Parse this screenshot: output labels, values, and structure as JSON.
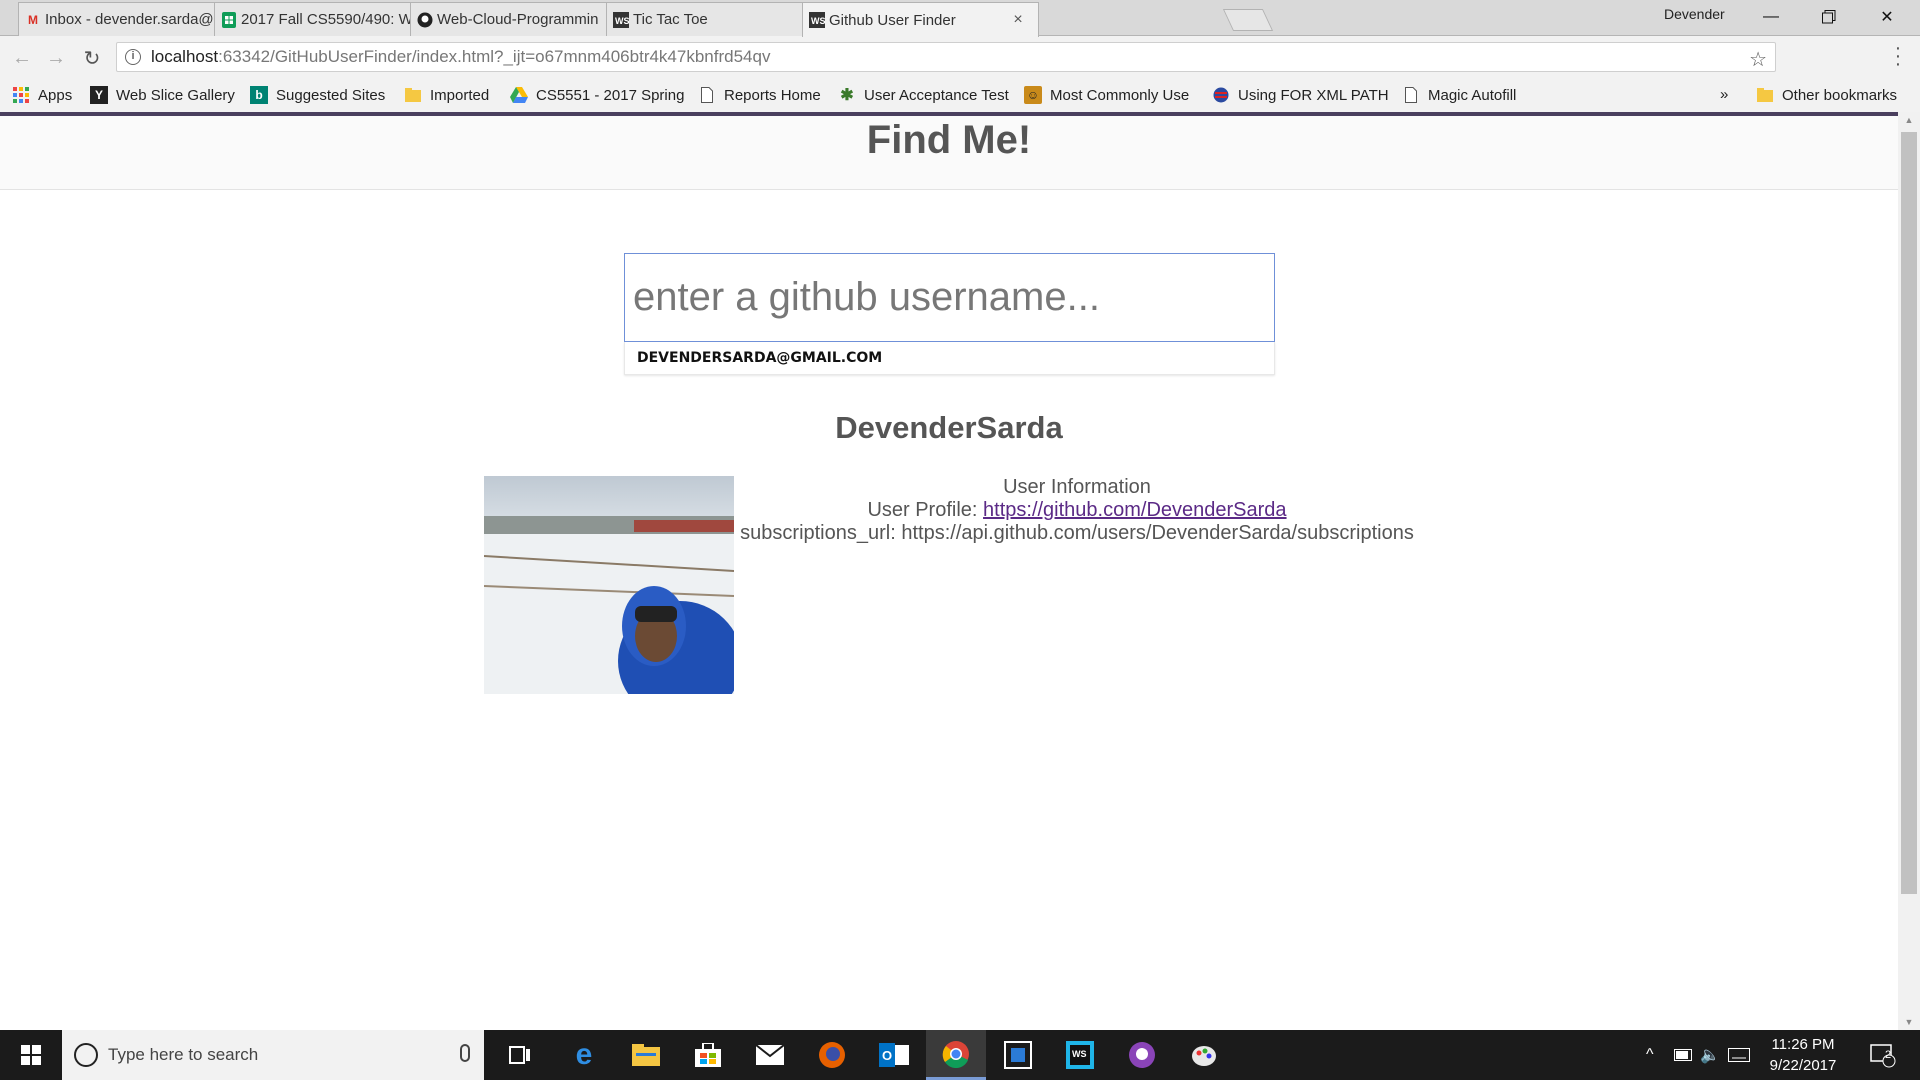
{
  "browser": {
    "tabs": [
      {
        "title": "Inbox - devender.sarda@",
        "icon": "gmail-icon"
      },
      {
        "title": "2017 Fall CS5590/490: W",
        "icon": "sheets-icon"
      },
      {
        "title": "Web-Cloud-Programmin",
        "icon": "github-icon"
      },
      {
        "title": "Tic Tac Toe",
        "icon": "webstorm-icon"
      },
      {
        "title": "Github User Finder",
        "icon": "webstorm-icon",
        "active": true
      }
    ],
    "profile_name": "Devender",
    "url": {
      "host": "localhost",
      "rest": ":63342/GitHubUserFinder/index.html?_ijt=o67mnm406btr4k47kbnfrd54qv"
    },
    "bookmarks": [
      {
        "label": "Apps",
        "icon": "apps-grid-icon"
      },
      {
        "label": "Web Slice Gallery",
        "icon": "web-slice-icon"
      },
      {
        "label": "Suggested Sites",
        "icon": "bing-icon"
      },
      {
        "label": "Imported",
        "icon": "folder-icon"
      },
      {
        "label": "CS5551 - 2017 Spring",
        "icon": "drive-icon"
      },
      {
        "label": "Reports Home",
        "icon": "page-icon"
      },
      {
        "label": "User Acceptance Test",
        "icon": "bug-icon"
      },
      {
        "label": "Most Commonly Use",
        "icon": "badge-icon"
      },
      {
        "label": "Using FOR XML PATH",
        "icon": "flag-globe-icon"
      },
      {
        "label": "Magic Autofill",
        "icon": "page-icon"
      }
    ],
    "overflow_label": "»",
    "other_bookmarks": "Other bookmarks"
  },
  "page": {
    "header_title": "Find Me!",
    "search": {
      "placeholder": "enter a github username...",
      "autocomplete": "DEVENDERSARDA@GMAIL.COM"
    },
    "user": {
      "login": "DevenderSarda",
      "info_heading": "User Information",
      "profile_label": "User Profile: ",
      "profile_url": "https://github.com/DevenderSarda",
      "subscriptions_label": "subscriptions_url: ",
      "subscriptions_url": "https://api.github.com/users/DevenderSarda/subscriptions"
    }
  },
  "taskbar": {
    "search_placeholder": "Type here to search",
    "time": "11:26 PM",
    "date": "9/22/2017",
    "notification_count": "2"
  },
  "colors": {
    "accent_bar": "#4a3f5e",
    "link_visited": "#5b2a86",
    "input_focus_border": "#6f90d8"
  }
}
